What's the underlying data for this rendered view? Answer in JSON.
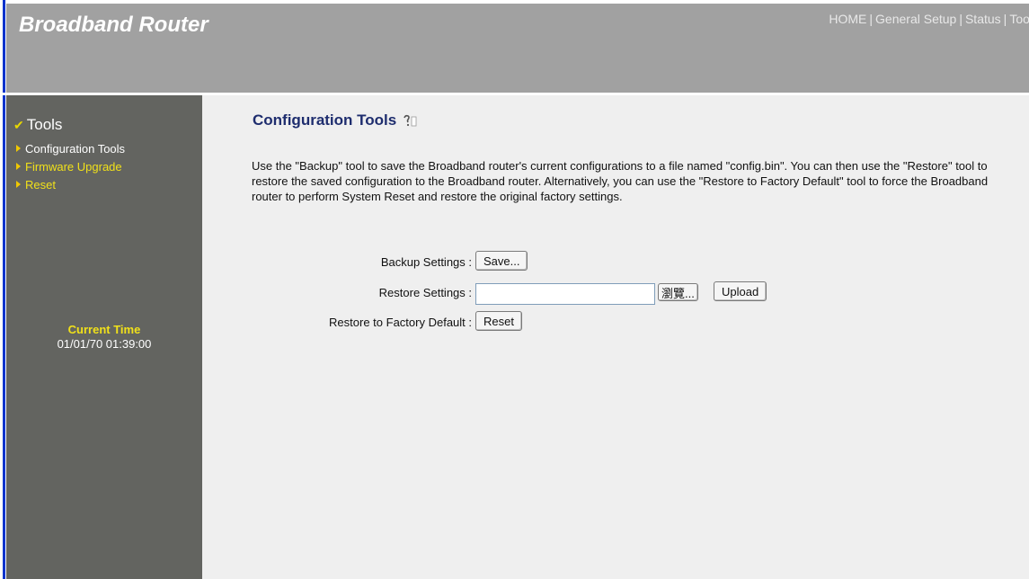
{
  "header": {
    "brand": "Broadband Router",
    "nav": [
      "HOME",
      "General Setup",
      "Status",
      "Tool"
    ],
    "nav_sep": "|"
  },
  "sidebar": {
    "title": "Tools",
    "items": [
      {
        "label": "Configuration Tools",
        "active": true
      },
      {
        "label": "Firmware Upgrade",
        "active": false
      },
      {
        "label": "Reset",
        "active": false
      }
    ],
    "time_label": "Current Time",
    "time_value": "01/01/70 01:39:00"
  },
  "main": {
    "title": "Configuration Tools",
    "description": "Use the \"Backup\" tool to save the Broadband router's current configurations to a file named \"config.bin\". You can then use the \"Restore\" tool to restore the saved configuration to the Broadband router. Alternatively, you can use the \"Restore to Factory Default\" tool to force the Broadband router to perform System Reset and restore the original factory settings.",
    "backup_label": "Backup Settings :",
    "save_button": "Save...",
    "restore_label": "Restore Settings :",
    "restore_file_value": "",
    "browse_button": "瀏覽...",
    "upload_button": "Upload",
    "factory_label": "Restore to Factory Default :",
    "reset_button": "Reset"
  },
  "colors": {
    "header_bg": "#a1a1a1",
    "sidebar_bg": "#636460",
    "main_bg": "#efefef",
    "menu_text": "#f0e01a",
    "title_text": "#1e2d6e"
  }
}
